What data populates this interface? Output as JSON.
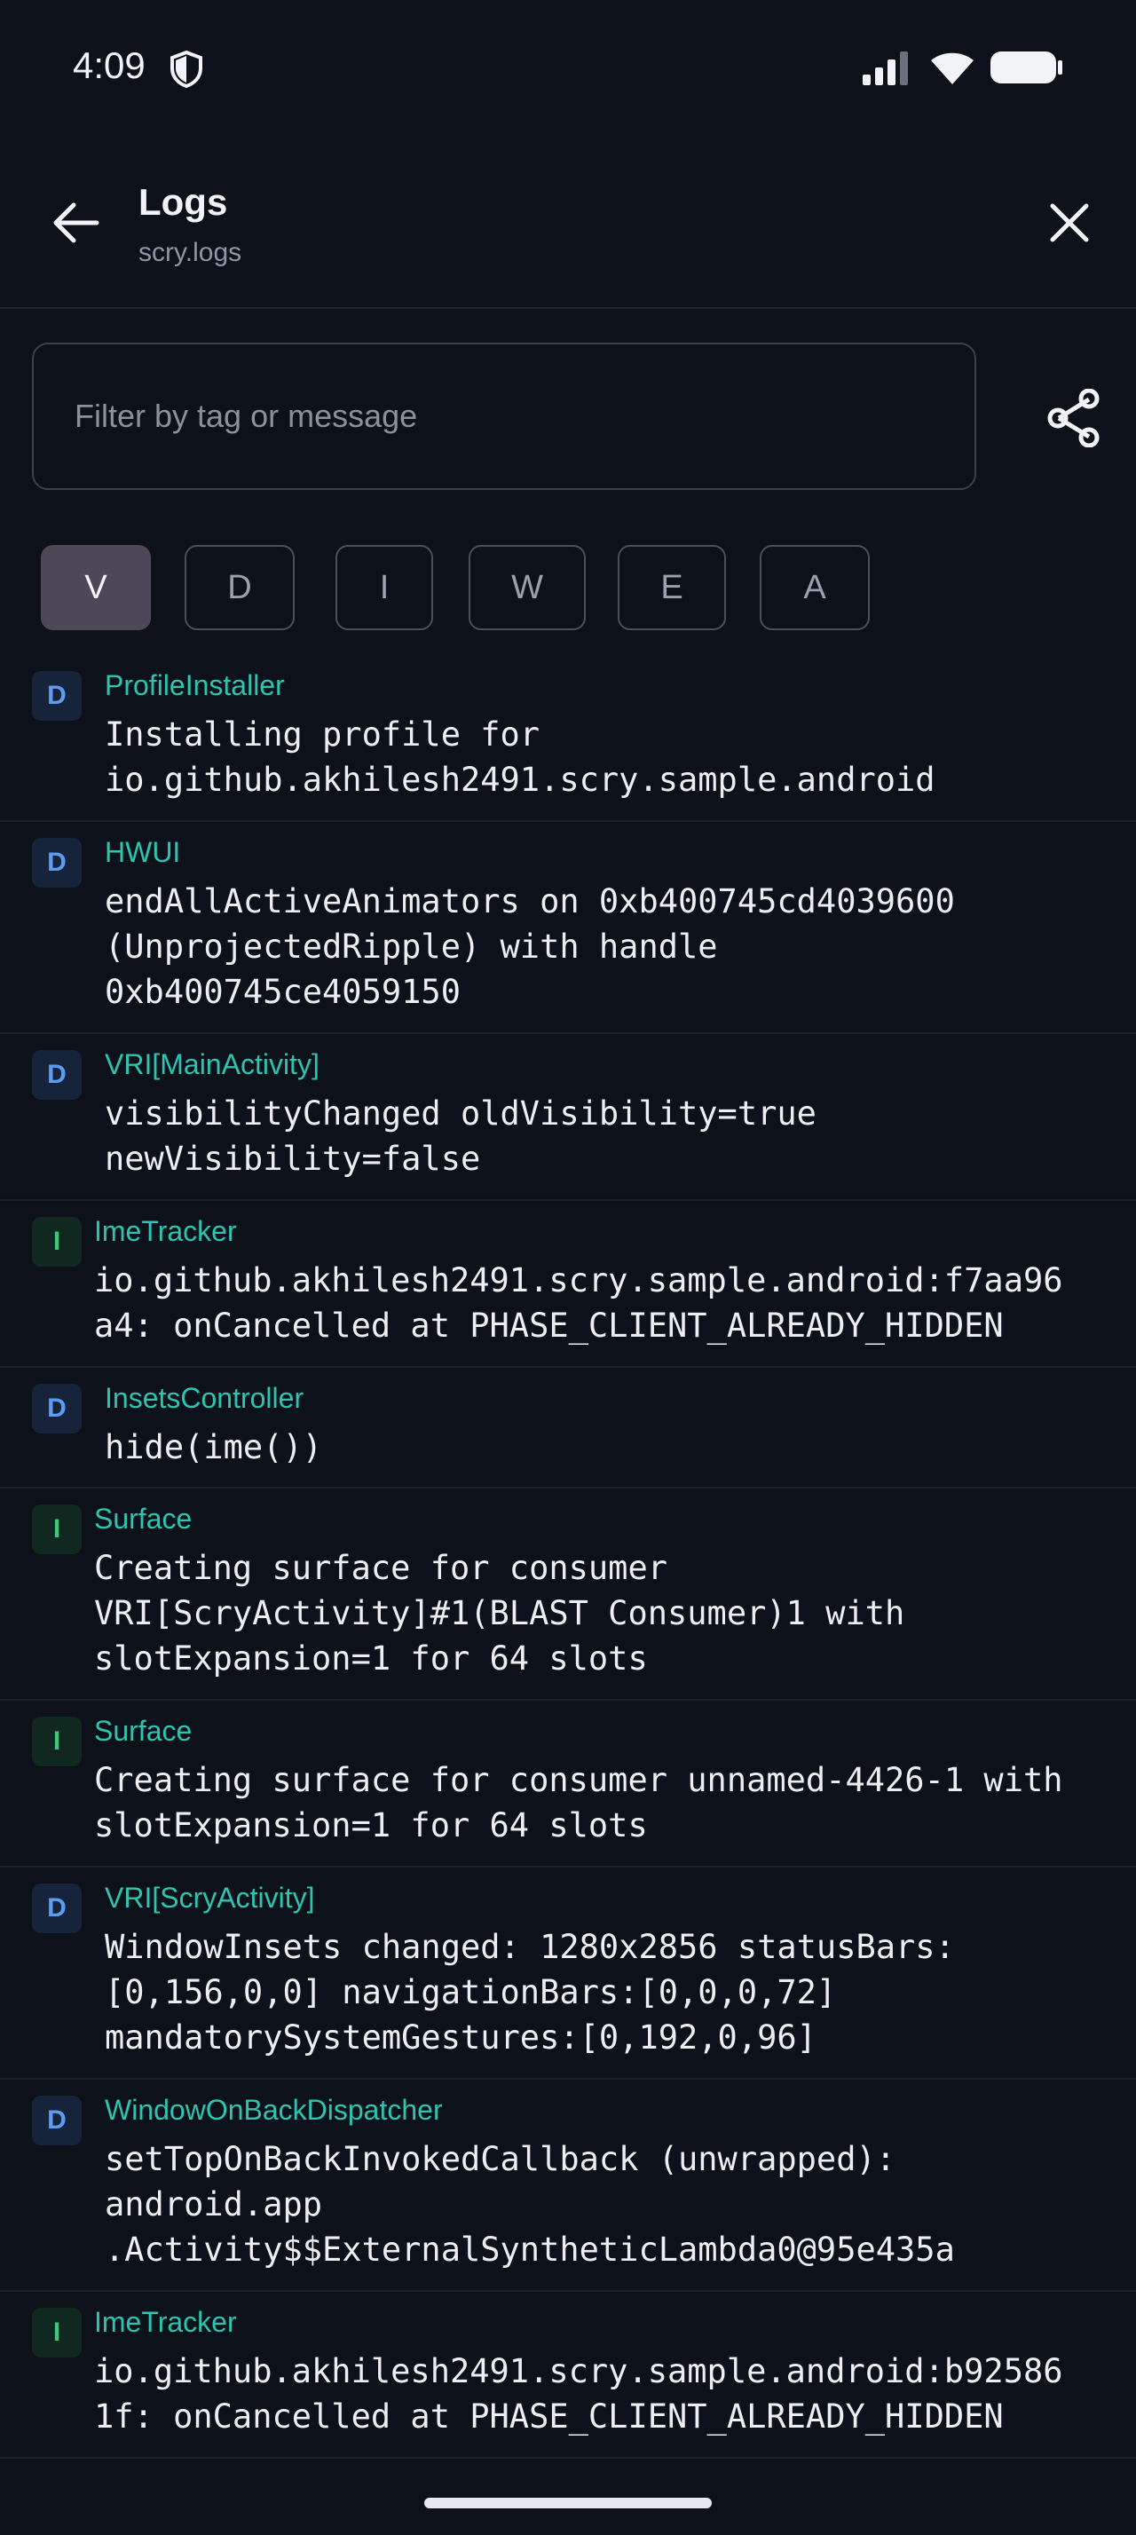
{
  "status_bar": {
    "time": "4:09"
  },
  "app_bar": {
    "title": "Logs",
    "subtitle": "scry.logs"
  },
  "filter": {
    "placeholder": "Filter by tag or message",
    "value": ""
  },
  "levels": [
    "V",
    "D",
    "I",
    "W",
    "E",
    "A"
  ],
  "selected_level": "V",
  "logs": [
    {
      "level": "D",
      "tag": "ProfileInstaller",
      "lines": [
        "Installing profile for",
        "io.github.akhilesh2491.scry.sample.android"
      ]
    },
    {
      "level": "D",
      "tag": "HWUI",
      "lines": [
        "endAllActiveAnimators on 0xb400745cd4039600",
        "(UnprojectedRipple) with handle",
        "0xb400745ce4059150"
      ]
    },
    {
      "level": "D",
      "tag": "VRI[MainActivity]",
      "lines": [
        "visibilityChanged oldVisibility=true",
        "newVisibility=false"
      ]
    },
    {
      "level": "I",
      "tag": "ImeTracker",
      "lines": [
        "io.github.akhilesh2491.scry.sample.android:f7aa96",
        "a4: onCancelled at PHASE_CLIENT_ALREADY_HIDDEN"
      ]
    },
    {
      "level": "D",
      "tag": "InsetsController",
      "lines": [
        "hide(ime())"
      ]
    },
    {
      "level": "I",
      "tag": "Surface",
      "lines": [
        "Creating surface for consumer",
        "VRI[ScryActivity]#1(BLAST Consumer)1 with",
        "slotExpansion=1 for 64 slots"
      ]
    },
    {
      "level": "I",
      "tag": "Surface",
      "lines": [
        "Creating surface for consumer unnamed-4426-1 with",
        "slotExpansion=1 for 64 slots"
      ]
    },
    {
      "level": "D",
      "tag": "VRI[ScryActivity]",
      "lines": [
        "WindowInsets changed: 1280x2856 statusBars:",
        "[0,156,0,0] navigationBars:[0,0,0,72]",
        "mandatorySystemGestures:[0,192,0,96]"
      ]
    },
    {
      "level": "D",
      "tag": "WindowOnBackDispatcher",
      "lines": [
        "setTopOnBackInvokedCallback (unwrapped):",
        "android.app",
        ".Activity$$ExternalSyntheticLambda0@95e435a"
      ]
    },
    {
      "level": "I",
      "tag": "ImeTracker",
      "lines": [
        "io.github.akhilesh2491.scry.sample.android:b92586",
        "1f: onCancelled at PHASE_CLIENT_ALREADY_HIDDEN"
      ]
    }
  ],
  "colors": {
    "background": "#0d111a",
    "tag": "#2ec4b0",
    "debug": "#5b9cf5",
    "info": "#3ec97a",
    "chip_active": "#4c4858"
  }
}
